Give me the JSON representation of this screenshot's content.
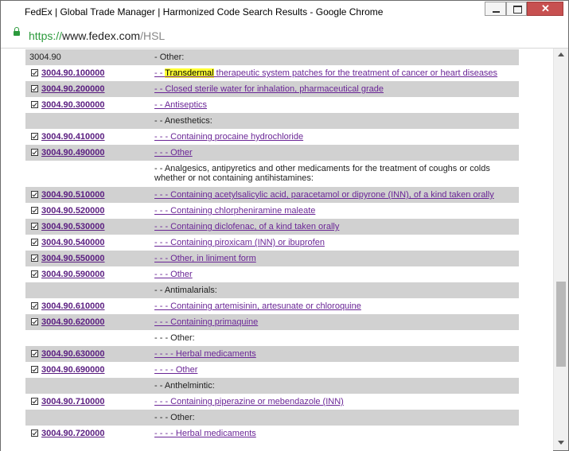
{
  "window": {
    "title": "FedEx | Global Trade Manager | Harmonized Code Search Results - Google Chrome"
  },
  "address": {
    "scheme": "https://",
    "host": "www.fedex.com",
    "path": "/HSL"
  },
  "rows": [
    {
      "code": "3004.90",
      "desc": "- Other:",
      "heading": true,
      "shaded": true
    },
    {
      "code": "3004.90.100000",
      "desc_prefix": "- - ",
      "desc_highlight": "Transdermal",
      "desc": " therapeutic system patches for the treatment of cancer or heart diseases"
    },
    {
      "code": "3004.90.200000",
      "desc": "- - Closed sterile water for inhalation, pharmaceutical grade ",
      "shaded": true
    },
    {
      "code": "3004.90.300000",
      "desc": "- - Antiseptics "
    },
    {
      "code": "",
      "desc": "- - Anesthetics:",
      "heading": true,
      "shaded": true
    },
    {
      "code": "3004.90.410000",
      "desc": "- - - Containing procaine hydrochloride "
    },
    {
      "code": "3004.90.490000",
      "desc": "- - - Other ",
      "shaded": true
    },
    {
      "code": "",
      "desc": "- - Analgesics, antipyretics and other medicaments for the treatment of coughs or colds whether or not containing antihistamines:",
      "heading": true
    },
    {
      "code": "3004.90.510000",
      "desc": "- - - Containing acetylsalicylic acid, paracetamol or dipyrone (INN), of a kind taken orally",
      "shaded": true
    },
    {
      "code": "3004.90.520000",
      "desc": "- - - Containing chlorpheniramine maleate"
    },
    {
      "code": "3004.90.530000",
      "desc": "- - - Containing diclofenac, of a kind taken orally",
      "shaded": true
    },
    {
      "code": "3004.90.540000",
      "desc": "- - - Containing piroxicam (INN) or ibuprofen"
    },
    {
      "code": "3004.90.550000",
      "desc": "- - - Other, in liniment form",
      "shaded": true
    },
    {
      "code": "3004.90.590000",
      "desc": "- - - Other "
    },
    {
      "code": "",
      "desc": "- - Antimalarials:",
      "heading": true,
      "shaded": true
    },
    {
      "code": "3004.90.610000",
      "desc": "- - - Containing artemisinin, artesunate or chloroquine"
    },
    {
      "code": "3004.90.620000",
      "desc": "- - - Containing primaquine",
      "shaded": true
    },
    {
      "code": "",
      "desc": "- - - Other:",
      "heading": true
    },
    {
      "code": "3004.90.630000",
      "desc": "- - - - Herbal medicaments",
      "shaded": true
    },
    {
      "code": "3004.90.690000",
      "desc": "- - - - Other "
    },
    {
      "code": "",
      "desc": "- - Anthelmintic:",
      "heading": true,
      "shaded": true
    },
    {
      "code": "3004.90.710000",
      "desc": "- - - Containing piperazine or mebendazole (INN)"
    },
    {
      "code": "",
      "desc": "- - - Other:",
      "heading": true,
      "shaded": true
    },
    {
      "code": "3004.90.720000",
      "desc": "- - - - Herbal medicaments"
    }
  ]
}
